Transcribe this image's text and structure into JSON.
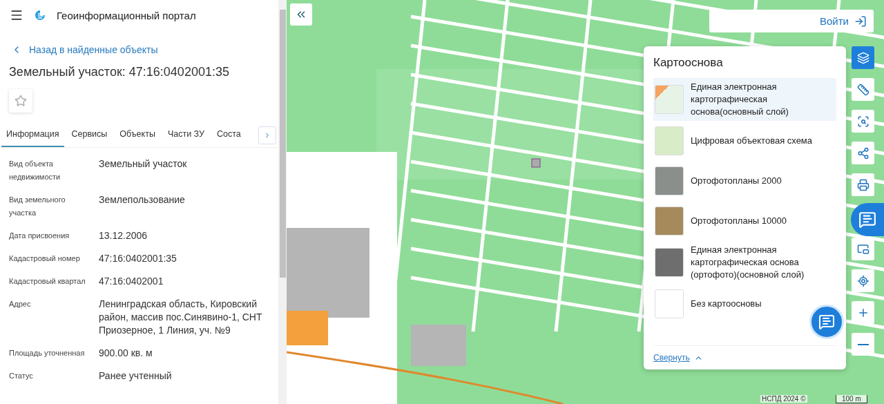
{
  "header": {
    "title": "Геоинформационный портал"
  },
  "back_link": "Назад в найденные объекты",
  "object_title": "Земельный участок: 47:16:0402001:35",
  "favorite": {
    "on": false
  },
  "tabs": [
    {
      "label": "Информация",
      "selected": true
    },
    {
      "label": "Сервисы",
      "selected": false
    },
    {
      "label": "Объекты",
      "selected": false
    },
    {
      "label": "Части ЗУ",
      "selected": false
    },
    {
      "label": "Соста",
      "selected": false
    }
  ],
  "properties": [
    {
      "label": "Вид объекта недвижимости",
      "value": "Земельный участок"
    },
    {
      "label": "Вид земельного участка",
      "value": "Землепользование"
    },
    {
      "label": "Дата присвоения",
      "value": "13.12.2006"
    },
    {
      "label": "Кадастровый номер",
      "value": "47:16:0402001:35"
    },
    {
      "label": "Кадастровый квартал",
      "value": "47:16:0402001"
    },
    {
      "label": "Адрес",
      "value": "Ленинградская область, Кировский район, массив пос.Синявино-1, СНТ Приозерное, 1 Линия, уч. №9"
    },
    {
      "label": "Площадь уточненная",
      "value": "900.00 кв. м"
    },
    {
      "label": "Статус",
      "value": "Ранее учтенный"
    }
  ],
  "login_button": "Войти",
  "basemap_panel": {
    "title": "Картооснова",
    "collapse_link": "Свернуть",
    "layers": [
      {
        "name": "Единая электронная картографическая основа(основный слой)",
        "selected": true
      },
      {
        "name": "Цифровая объектовая схема",
        "selected": false
      },
      {
        "name": "Ортофотопланы 2000",
        "selected": false
      },
      {
        "name": "Ортофотопланы 10000",
        "selected": false
      },
      {
        "name": "Единая электронная картографическая основа (ортофото)(основной слой)",
        "selected": false
      },
      {
        "name": "Без картоосновы",
        "selected": false
      }
    ]
  },
  "map_tools": [
    {
      "selected": true
    },
    {
      "selected": false
    },
    {
      "selected": false
    },
    {
      "selected": false
    },
    {
      "selected": false
    },
    {
      "selected": false
    },
    {
      "selected": false
    },
    {
      "selected": false
    },
    {
      "selected": false
    }
  ],
  "attribution": "НСПД 2024 ©",
  "scale": "100 m"
}
